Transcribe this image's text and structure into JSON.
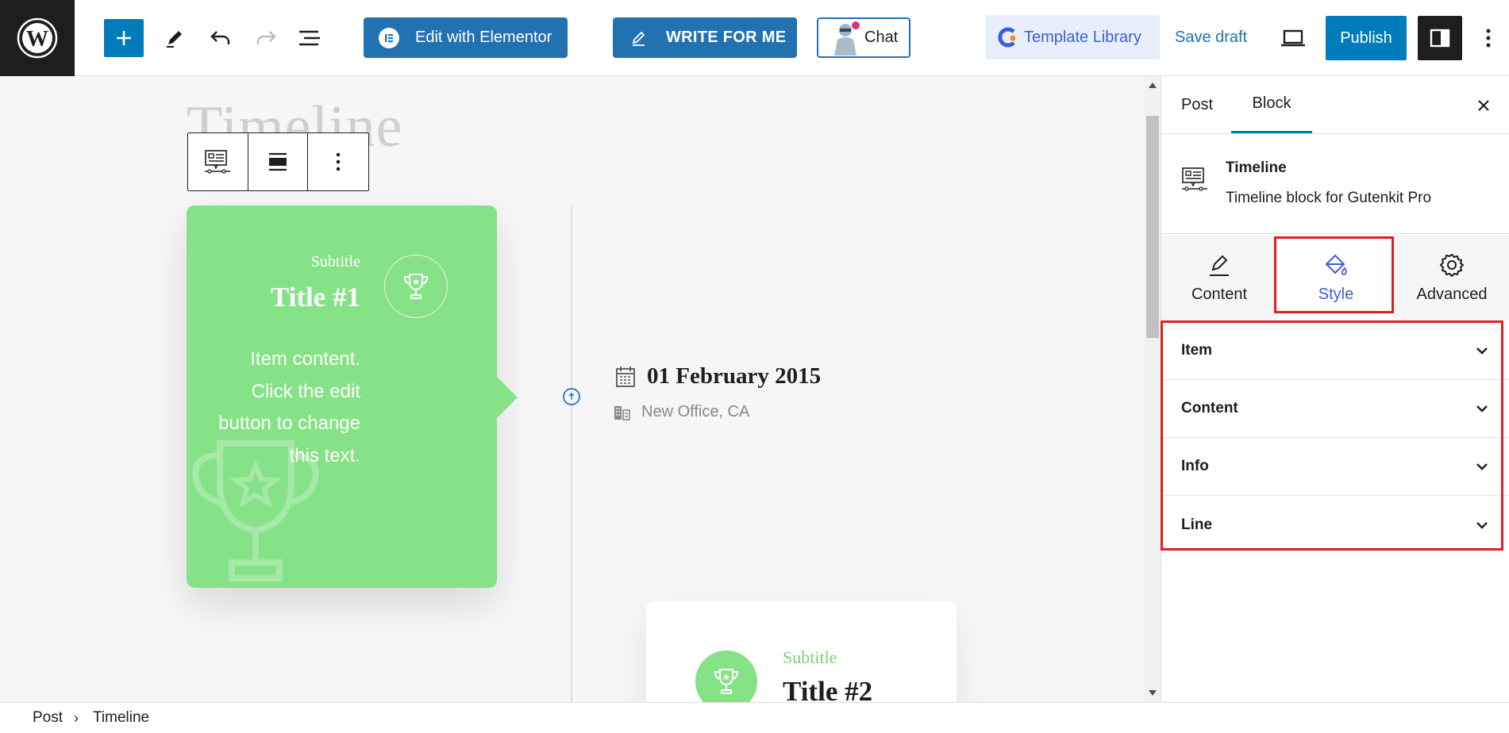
{
  "toolbar": {
    "elementor_label": "Edit with Elementor",
    "write_label": "WRITE FOR ME",
    "chat_label": "Chat",
    "template_library_label": "Template Library",
    "save_draft_label": "Save draft",
    "publish_label": "Publish",
    "accent_color": "#007cba"
  },
  "canvas": {
    "page_title": "Timeline",
    "item1": {
      "subtitle": "Subtitle",
      "title": "Title #1",
      "content": "Item content. Click the edit button to change this text.",
      "color": "#86e286"
    },
    "info": {
      "date": "01 February 2015",
      "location": "New Office, CA"
    },
    "item2": {
      "subtitle": "Subtitle",
      "title": "Title #2"
    }
  },
  "sidebar": {
    "tabs": [
      "Post",
      "Block"
    ],
    "active_tab": "Block",
    "block_name": "Timeline",
    "block_description": "Timeline block for Gutenkit Pro",
    "modes": [
      "Content",
      "Style",
      "Advanced"
    ],
    "active_mode": "Style",
    "sections": [
      "Item",
      "Content",
      "Info",
      "Line"
    ],
    "highlight_color": "#e02020"
  },
  "breadcrumb": [
    "Post",
    "Timeline"
  ]
}
